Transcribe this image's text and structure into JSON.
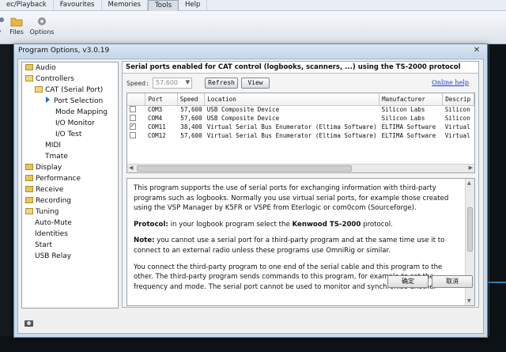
{
  "app": {
    "menu": [
      "ec/Playback",
      "Favourites",
      "Memories",
      "Tools",
      "Help"
    ],
    "active_menu": "Tools",
    "toolbar": [
      {
        "label": "y",
        "icon": "key-icon"
      },
      {
        "label": "Files",
        "icon": "folder-icon"
      },
      {
        "label": "Options",
        "icon": "gear-icon"
      }
    ]
  },
  "dialog": {
    "title": "Program Options, v3.0.19",
    "tree": [
      {
        "label": "Audio",
        "icon": "folder-icon",
        "level": 0
      },
      {
        "label": "Controllers",
        "icon": "folder-open-icon",
        "level": 0
      },
      {
        "label": "CAT (Serial Port)",
        "icon": "folder-open-icon",
        "level": 1
      },
      {
        "label": "Port Selection",
        "icon": "arrow-icon",
        "level": 2,
        "selected": true
      },
      {
        "label": "Mode Mapping",
        "icon": "none",
        "level": 2
      },
      {
        "label": "I/O Monitor",
        "icon": "none",
        "level": 2
      },
      {
        "label": "I/O Test",
        "icon": "none",
        "level": 2
      },
      {
        "label": "MIDI",
        "icon": "none",
        "level": 1
      },
      {
        "label": "Tmate",
        "icon": "none",
        "level": 1
      },
      {
        "label": "Display",
        "icon": "folder-icon",
        "level": 0
      },
      {
        "label": "Performance",
        "icon": "folder-icon",
        "level": 0
      },
      {
        "label": "Receive",
        "icon": "folder-icon",
        "level": 0
      },
      {
        "label": "Recording",
        "icon": "folder-icon",
        "level": 0
      },
      {
        "label": "Tuning",
        "icon": "folder-open-icon",
        "level": 0
      },
      {
        "label": "Auto-Mute",
        "icon": "none",
        "level": 0
      },
      {
        "label": "Identities",
        "icon": "none",
        "level": 0
      },
      {
        "label": "Start",
        "icon": "none",
        "level": 0
      },
      {
        "label": "USB Relay",
        "icon": "none",
        "level": 0
      }
    ],
    "panel": {
      "header": "Serial ports enabled for CAT control (logbooks, scanners, ...) using the TS-2000 protocol",
      "speed_label": "Speed:",
      "speed_value": "57,600",
      "refresh_button": "Refresh",
      "view_button": "View",
      "online_help": "Online help",
      "columns": [
        "",
        "Port",
        "Speed",
        "Location",
        "Manufacturer",
        "Descrip"
      ],
      "rows": [
        {
          "checked": false,
          "port": "COM3",
          "speed": "57,600",
          "location": "USB Composite Device",
          "manufacturer": "Silicon Labs",
          "description": "Silicon"
        },
        {
          "checked": false,
          "port": "COM4",
          "speed": "57,600",
          "location": "USB Composite Device",
          "manufacturer": "Silicon Labs",
          "description": "Silicon"
        },
        {
          "checked": true,
          "port": "COM11",
          "speed": "38,400",
          "location": "Virtual Serial Bus Enumerator (Eltima Software)",
          "manufacturer": "ELTIMA Software",
          "description": "Virtual"
        },
        {
          "checked": false,
          "port": "COM12",
          "speed": "57,600",
          "location": "Virtual Serial Bus Enumerator (Eltima Software)",
          "manufacturer": "ELTIMA Software",
          "description": "Virtual"
        }
      ],
      "description": {
        "p1": "This program supports the use of serial ports for exchanging information with third-party programs such as logbooks. Normally you use virtual serial ports, for example those created using the VSP Manager by K5FR or VSPE from Eterlogic or com0com (Sourceforge).",
        "p2_label": "Protocol:",
        "p2_text": " in your logbook program select the ",
        "p2_bold": "Kenwood TS-2000",
        "p2_end": " protocol.",
        "p3_label": "Note:",
        "p3_text": " you cannot use a serial port for a third-party program and at the same time use it to connect to an external radio unless these programs use OmniRig or similar.",
        "p4": "You connect the third-party program to one end of the serial cable and this program to the other. The third-party program sends commands to this program, for example to set the frequency and mode. The serial port cannot be used to monitor and synchronise another"
      }
    },
    "ok_button": "确定",
    "cancel_button": "取消"
  }
}
